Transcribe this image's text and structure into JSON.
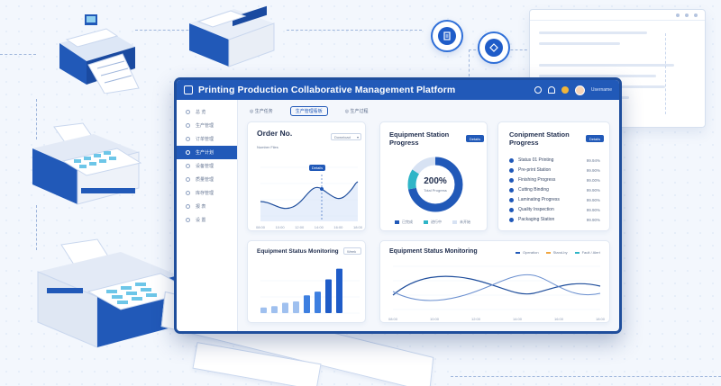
{
  "app": {
    "title": "Printing Production Collaborative Management Platform",
    "username": "Username"
  },
  "sidebar": {
    "items": [
      {
        "label": "总 览",
        "active": false
      },
      {
        "label": "生产管理",
        "active": false
      },
      {
        "label": "订单管理",
        "active": false
      },
      {
        "label": "生产计划",
        "active": true
      },
      {
        "label": "设备管理",
        "active": false
      },
      {
        "label": "质量管理",
        "active": false
      },
      {
        "label": "库存管理",
        "active": false
      },
      {
        "label": "报 表",
        "active": false
      },
      {
        "label": "设 置",
        "active": false
      }
    ]
  },
  "tabs": [
    {
      "label": "◎ 生产任务",
      "active": false
    },
    {
      "label": "生产管理看板",
      "active": true
    },
    {
      "label": "◎ 生产过程",
      "active": false
    }
  ],
  "order_card": {
    "title": "Order No.",
    "subtitle": "Number Files",
    "dropdown": "Download",
    "tooltip": "Details",
    "x_labels": [
      "08:00",
      "10:00",
      "12:00",
      "14:00",
      "16:00",
      "18:00"
    ]
  },
  "station_card": {
    "title": "Equipment Station Progress",
    "button": "Details",
    "percent": "200%",
    "center_sub": "Total Progress",
    "progress": 0.72,
    "legend": [
      "已完成",
      "进行中",
      "未开始"
    ],
    "colors": {
      "done": "#2159b8",
      "progress": "#2fb5c7",
      "rest": "#d7e2f3"
    }
  },
  "station_list_card": {
    "title": "Conipment Station Progress",
    "button": "Details",
    "rows": [
      {
        "label": "Status 01 Printing",
        "value": "99.94%"
      },
      {
        "label": "Pre-print Station",
        "value": "99.90%"
      },
      {
        "label": "Finishing Progress",
        "value": "99.00%"
      },
      {
        "label": "Cutting Binding",
        "value": "99.90%"
      },
      {
        "label": "Laminating Progress",
        "value": "99.90%"
      },
      {
        "label": "Quality Inspection",
        "value": "99.90%"
      },
      {
        "label": "Packaging Station",
        "value": "99.90%"
      }
    ]
  },
  "status_bar_card": {
    "title": "Equipment Status Monitoring",
    "dropdown": "Week",
    "bars": [
      0.12,
      0.15,
      0.22,
      0.25,
      0.38,
      0.46,
      0.72,
      0.95
    ]
  },
  "status_line_card": {
    "title": "Equipment Status Monitoring",
    "legend": [
      "Operation",
      "Stand-by",
      "Fault / Alert"
    ],
    "x_labels": [
      "08:00",
      "10:00",
      "12:00",
      "14:00",
      "16:00",
      "18:00"
    ]
  }
}
